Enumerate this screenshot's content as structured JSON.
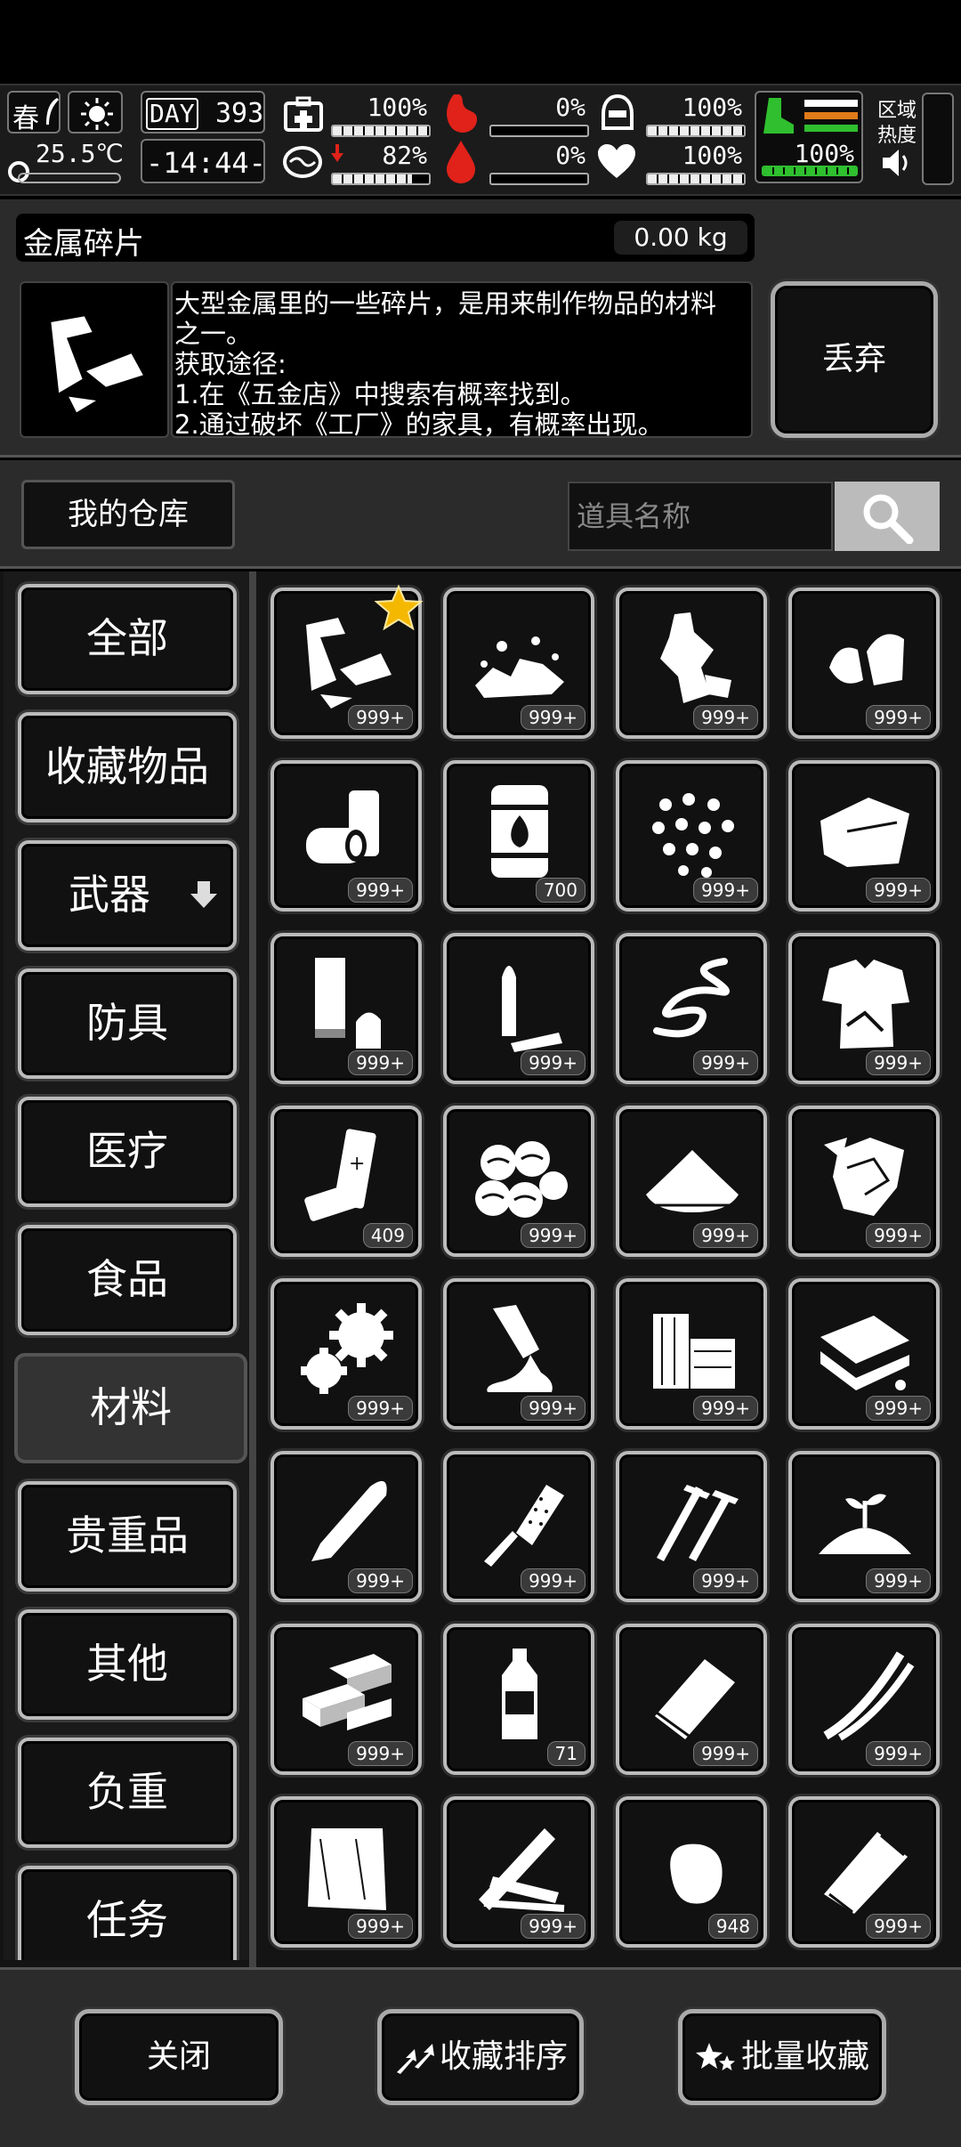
{
  "status": {
    "season": "春",
    "temperature": "25.5℃",
    "day_label": "DAY",
    "day_number": "393",
    "time": "-14:44-",
    "health_pct": "100%",
    "health_value": 1.0,
    "stamina_pct": "82%",
    "stamina_value": 0.82,
    "hunger_pct": "0%",
    "hunger_value": 0.0,
    "thirst_pct": "0%",
    "thirst_value": 0.0,
    "armor_pct": "100%",
    "armor_value": 1.0,
    "mood_pct": "100%",
    "mood_value": 1.0,
    "speed_pct": "100%",
    "speed_value": 1.0,
    "zone_heat_label_1": "区域",
    "zone_heat_label_2": "热度",
    "colors": {
      "hunger": "#e0221a",
      "speed": "#2fbf2f",
      "stripe_orange": "#e07b1a"
    }
  },
  "item": {
    "name": "金属碎片",
    "weight": "0.00 kg",
    "description": "大型金属里的一些碎片，是用来制作物品的材料\n之一。\n获取途径:\n1.在《五金店》中搜索有概率找到。\n2.通过破坏《工厂》的家具，有概率出现。",
    "discard_label": "丢弃",
    "icon": "metal-shard-icon"
  },
  "storage": {
    "label": "我的仓库",
    "search_placeholder": "道具名称"
  },
  "categories": [
    {
      "label": "全部",
      "active": false
    },
    {
      "label": "收藏物品",
      "active": false
    },
    {
      "label": "武器",
      "active": false,
      "has_arrow": true
    },
    {
      "label": "防具",
      "active": false
    },
    {
      "label": "医疗",
      "active": false
    },
    {
      "label": "食品",
      "active": false
    },
    {
      "label": "材料",
      "active": true
    },
    {
      "label": "贵重品",
      "active": false
    },
    {
      "label": "其他",
      "active": false
    },
    {
      "label": "负重",
      "active": false
    },
    {
      "label": "任务",
      "active": false
    }
  ],
  "items": [
    {
      "icon": "metal-shard-icon",
      "count": "999+",
      "favorite": true
    },
    {
      "icon": "rubble-icon",
      "count": "999+"
    },
    {
      "icon": "crushed-bottle-icon",
      "count": "999+"
    },
    {
      "icon": "bullet-tips-icon",
      "count": "999+"
    },
    {
      "icon": "cans-icon",
      "count": "999+"
    },
    {
      "icon": "fuel-barrel-icon",
      "count": "700"
    },
    {
      "icon": "pellets-icon",
      "count": "999+"
    },
    {
      "icon": "cloth-sheets-icon",
      "count": "999+"
    },
    {
      "icon": "shell-casing-icon",
      "count": "999+"
    },
    {
      "icon": "rifle-bullet-icon",
      "count": "999+"
    },
    {
      "icon": "spring-icon",
      "count": "999+"
    },
    {
      "icon": "rag-shirt-icon",
      "count": "999+"
    },
    {
      "icon": "battery-icon",
      "count": "409"
    },
    {
      "icon": "cotton-balls-icon",
      "count": "999+"
    },
    {
      "icon": "powder-pile-icon",
      "count": "999+"
    },
    {
      "icon": "crumpled-paper-icon",
      "count": "999+"
    },
    {
      "icon": "gears-icon",
      "count": "999+"
    },
    {
      "icon": "glue-tube-icon",
      "count": "999+"
    },
    {
      "icon": "wood-blocks-icon",
      "count": "999+"
    },
    {
      "icon": "sponge-stack-icon",
      "count": "999+"
    },
    {
      "icon": "bullet-head-icon",
      "count": "999+"
    },
    {
      "icon": "file-tool-icon",
      "count": "999+"
    },
    {
      "icon": "screws-icon",
      "count": "999+"
    },
    {
      "icon": "soil-sprout-icon",
      "count": "999+"
    },
    {
      "icon": "bricks-icon",
      "count": "999+"
    },
    {
      "icon": "water-bottle-icon",
      "count": "71"
    },
    {
      "icon": "snack-pack-icon",
      "count": "999+"
    },
    {
      "icon": "wires-icon",
      "count": "999+"
    },
    {
      "icon": "fabric-icon",
      "count": "999+"
    },
    {
      "icon": "planks-icon",
      "count": "999+"
    },
    {
      "icon": "round-pebble-icon",
      "count": "948"
    },
    {
      "icon": "paper-bag-icon",
      "count": "999+"
    }
  ],
  "buttons": {
    "close": "关闭",
    "sort_favorites": "收藏排序",
    "batch_favorite": "批量收藏"
  }
}
